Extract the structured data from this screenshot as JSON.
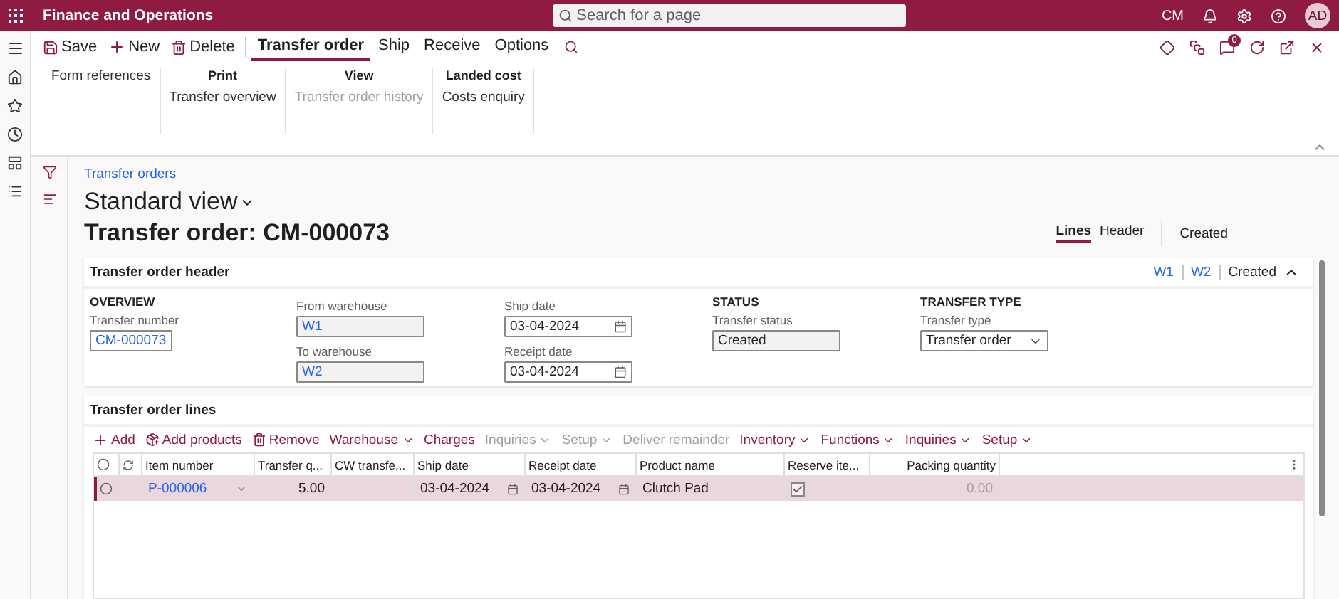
{
  "app": {
    "title": "Finance and Operations",
    "search_placeholder": "Search for a page",
    "company": "CM",
    "avatar": "AD"
  },
  "action_pane": {
    "commands": [
      {
        "kind": "save",
        "label": "Save"
      },
      {
        "kind": "new",
        "label": "New"
      },
      {
        "kind": "delete",
        "label": "Delete"
      }
    ],
    "tabs": [
      {
        "label": "Transfer order",
        "selected": true
      },
      {
        "label": "Ship",
        "selected": false
      },
      {
        "label": "Receive",
        "selected": false
      },
      {
        "label": "Options",
        "selected": false
      }
    ],
    "groups": [
      {
        "items": [
          {
            "label": "Form references",
            "disabled": false
          }
        ]
      },
      {
        "title": "Print",
        "items": [
          {
            "label": "Transfer overview",
            "disabled": false
          }
        ]
      },
      {
        "title": "View",
        "items": [
          {
            "label": "Transfer order history",
            "disabled": true
          }
        ]
      },
      {
        "title": "Landed cost",
        "items": [
          {
            "label": "Costs enquiry",
            "disabled": false
          }
        ]
      }
    ],
    "comments_count": "0"
  },
  "page": {
    "breadcrumb": "Transfer orders",
    "view": "Standard view",
    "title": "Transfer order: CM-000073",
    "tabs": [
      {
        "label": "Lines",
        "selected": true
      },
      {
        "label": "Header",
        "selected": false
      }
    ],
    "status": "Created"
  },
  "header_section": {
    "title": "Transfer order header",
    "summary_links": [
      "W1",
      "W2"
    ],
    "summary_status": "Created",
    "expanded": true,
    "groups": [
      {
        "heading": "OVERVIEW",
        "fields": [
          {
            "kind": "text",
            "label": "Transfer number",
            "value": "CM-000073",
            "link": true
          }
        ]
      },
      {
        "fields": [
          {
            "kind": "readonly",
            "label": "From warehouse",
            "value": "W1",
            "link": true
          },
          {
            "kind": "readonly",
            "label": "To warehouse",
            "value": "W2",
            "link": true
          }
        ]
      },
      {
        "fields": [
          {
            "kind": "date",
            "label": "Ship date",
            "value": "03-04-2024",
            "link": false
          },
          {
            "kind": "date",
            "label": "Receipt date",
            "value": "03-04-2024",
            "link": false
          }
        ]
      },
      {
        "heading": "STATUS",
        "fields": [
          {
            "kind": "readonly",
            "label": "Transfer status",
            "value": "Created",
            "link": false
          }
        ]
      },
      {
        "heading": "TRANSFER TYPE",
        "fields": [
          {
            "kind": "select",
            "label": "Transfer type",
            "value": "Transfer order",
            "link": false
          }
        ]
      }
    ]
  },
  "lines_section": {
    "title": "Transfer order lines",
    "toolbar": [
      {
        "kind": "add",
        "label": "Add",
        "disabled": false
      },
      {
        "kind": "add_products",
        "label": "Add products",
        "disabled": false
      },
      {
        "kind": "remove",
        "label": "Remove",
        "disabled": false
      },
      {
        "kind": "menu",
        "label": "Warehouse",
        "disabled": false
      },
      {
        "kind": "button",
        "label": "Charges",
        "disabled": false
      },
      {
        "kind": "menu",
        "label": "Inquiries",
        "disabled": true
      },
      {
        "kind": "menu",
        "label": "Setup",
        "disabled": true
      },
      {
        "kind": "button",
        "label": "Deliver remainder",
        "disabled": true
      },
      {
        "kind": "menu",
        "label": "Inventory",
        "disabled": false
      },
      {
        "kind": "menu",
        "label": "Functions",
        "disabled": false
      },
      {
        "kind": "menu",
        "label": "Inquiries",
        "disabled": false
      },
      {
        "kind": "menu",
        "label": "Setup",
        "disabled": false
      }
    ],
    "all_selected": false,
    "columns": [
      {
        "label": "Item number",
        "kind": "text"
      },
      {
        "label": "Transfer q...",
        "kind": "text"
      },
      {
        "label": "CW transfe...",
        "kind": "text"
      },
      {
        "label": "Ship date",
        "kind": "text"
      },
      {
        "label": "Receipt date",
        "kind": "text"
      },
      {
        "label": "Product name",
        "kind": "text"
      },
      {
        "label": "Reserve ite...",
        "kind": "text"
      },
      {
        "label": "Packing quantity",
        "kind": "numeric"
      }
    ],
    "rows": [
      {
        "selected": true,
        "cells": [
          {
            "kind": "lookup",
            "value": "P-000006"
          },
          {
            "kind": "number",
            "value": "5.00",
            "disabled": false
          },
          {
            "kind": "blank"
          },
          {
            "kind": "date",
            "value": "03-04-2024"
          },
          {
            "kind": "date",
            "value": "03-04-2024"
          },
          {
            "kind": "text",
            "value": "Clutch Pad"
          },
          {
            "kind": "checkbox",
            "checked": true
          },
          {
            "kind": "number",
            "value": "0.00",
            "disabled": true
          }
        ]
      }
    ]
  }
}
